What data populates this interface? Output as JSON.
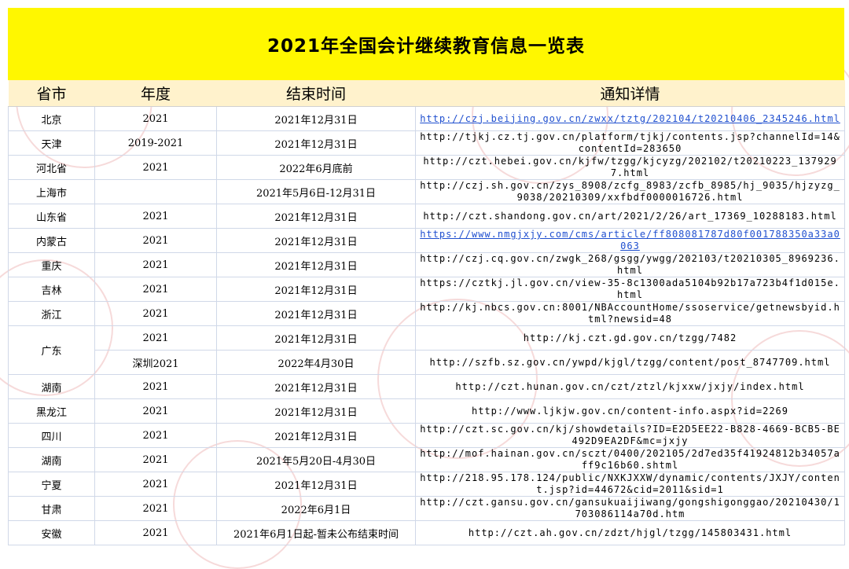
{
  "title": "2021年全国会计继续教育信息一览表",
  "headers": [
    "省市",
    "年度",
    "结束时间",
    "通知详情"
  ],
  "rows": [
    {
      "province": "北京",
      "year": "2021",
      "end": "2021年12月31日",
      "url": "http://czj.beijing.gov.cn/zwxx/tztg/202104/t20210406_2345246.html",
      "link": true
    },
    {
      "province": "天津",
      "year": "2019-2021",
      "end": "2021年12月31日",
      "url": "http://tjkj.cz.tj.gov.cn/platform/tjkj/contents.jsp?channelId=14&contentId=283650",
      "link": false
    },
    {
      "province": "河北省",
      "year": "2021",
      "end": "2022年6月底前",
      "url": "http://czt.hebei.gov.cn/kjfw/tzgg/kjcyzg/202102/t20210223_1379297.html",
      "link": false
    },
    {
      "province": "上海市",
      "year": "",
      "end": "2021年5月6日-12月31日",
      "url": "http://czj.sh.gov.cn/zys_8908/zcfg_8983/zcfb_8985/hj_9035/hjzyzg_9038/20210309/xxfbdf0000016726.html",
      "link": false
    },
    {
      "province": "山东省",
      "year": "2021",
      "end": "2021年12月31日",
      "url": "http://czt.shandong.gov.cn/art/2021/2/26/art_17369_10288183.html",
      "link": false
    },
    {
      "province": "内蒙古",
      "year": "2021",
      "end": "2021年12月31日",
      "url": "https://www.nmgjxjy.com/cms/article/ff808081787d80f001788350a33a0063",
      "link": true
    },
    {
      "province": "重庆",
      "year": "2021",
      "end": "2021年12月31日",
      "url": "http://czj.cq.gov.cn/zwgk_268/gsgg/ywgg/202103/t20210305_8969236.html",
      "link": false
    },
    {
      "province": "吉林",
      "year": "2021",
      "end": "2021年12月31日",
      "url": "https://cztkj.jl.gov.cn/view-35-8c1300ada5104b92b17a723b4f1d015e.html",
      "link": false
    },
    {
      "province": "浙江",
      "year": "2021",
      "end": "2021年12月31日",
      "url": "http://kj.nbcs.gov.cn:8001/NBAccountHome/ssoservice/getnewsbyid.html?newsid=48",
      "link": false
    },
    {
      "province": "广东",
      "year": "2021",
      "end": "2021年12月31日",
      "url": "http://kj.czt.gd.gov.cn/tzgg/7482",
      "link": false
    },
    {
      "province": "",
      "year": "深圳2021",
      "end": "2022年4月30日",
      "url": "http://szfb.sz.gov.cn/ywpd/kjgl/tzgg/content/post_8747709.html",
      "link": false
    },
    {
      "province": "湖南",
      "year": "2021",
      "end": "2021年12月31日",
      "url": "http://czt.hunan.gov.cn/czt/ztzl/kjxxw/jxjy/index.html",
      "link": false
    },
    {
      "province": "黑龙江",
      "year": "2021",
      "end": "2021年12月31日",
      "url": "http://www.ljkjw.gov.cn/content-info.aspx?id=2269",
      "link": false
    },
    {
      "province": "四川",
      "year": "2021",
      "end": "2021年12月31日",
      "url": "http://czt.sc.gov.cn/kj/showdetails?ID=E2D5EE22-B828-4669-BCB5-BE492D9EA2DF&mc=jxjy",
      "link": false
    },
    {
      "province": "湖南",
      "year": "2021",
      "end": "2021年5月20日-4月30日",
      "url": "http://mof.hainan.gov.cn/sczt/0400/202105/2d7ed35f41924812b34057aff9c16b60.shtml",
      "link": false
    },
    {
      "province": "宁夏",
      "year": "2021",
      "end": "2021年12月31日",
      "url": "http://218.95.178.124/public/NXKJXXW/dynamic/contents/JXJY/content.jsp?id=44672&cid=2011&sid=1",
      "link": false
    },
    {
      "province": "甘肃",
      "year": "2021",
      "end": "2022年6月1日",
      "url": "http://czt.gansu.gov.cn/gansukuaijiwang/gongshigonggao/20210430/1703086114a70d.htm",
      "link": false
    },
    {
      "province": "安徽",
      "year": "2021",
      "end": "2021年6月1日起-暂未公布结束时间",
      "url": "http://czt.ah.gov.cn/zdzt/hjgl/tzgg/145803431.html",
      "link": false
    }
  ]
}
